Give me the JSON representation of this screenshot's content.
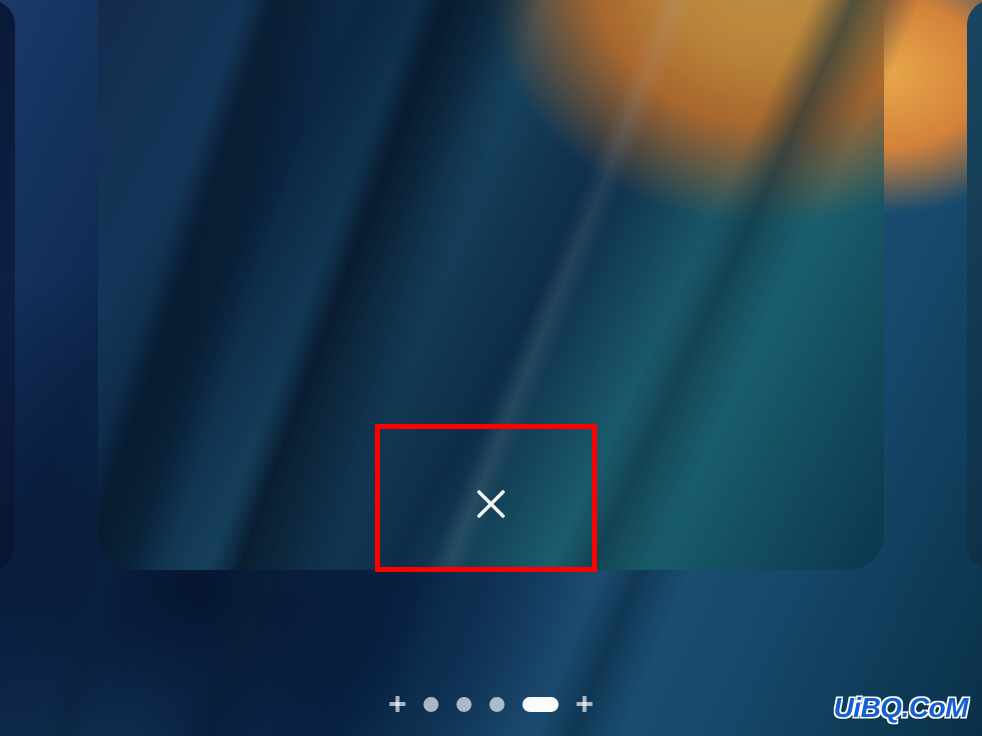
{
  "editor": {
    "delete_button_icon": "close-x",
    "highlight_color": "#ff0000"
  },
  "page_indicators": {
    "items": [
      {
        "type": "add",
        "icon": "plus"
      },
      {
        "type": "page",
        "active": false
      },
      {
        "type": "page",
        "active": false
      },
      {
        "type": "page",
        "active": false
      },
      {
        "type": "page",
        "active": true
      },
      {
        "type": "add",
        "icon": "plus"
      }
    ]
  },
  "watermark": {
    "text": "UiBQ.CoM"
  }
}
